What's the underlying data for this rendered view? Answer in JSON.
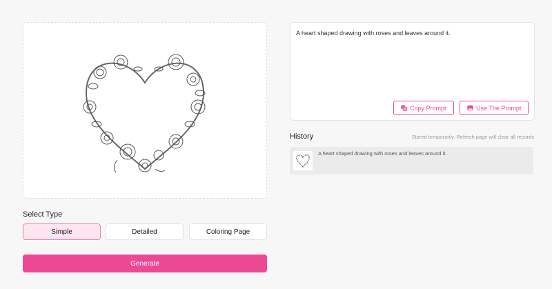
{
  "image": {
    "icon": "heart-rose-wreath-drawing"
  },
  "select_type": {
    "label": "Select Type",
    "options": [
      "Simple",
      "Detailed",
      "Coloring Page"
    ],
    "selected": "Simple"
  },
  "generate_label": "Generate",
  "prompt": {
    "text": "A heart shaped drawing with roses and leaves around it.",
    "copy_label": "Copy Prompt",
    "use_label": "Use The Prompt"
  },
  "history": {
    "title": "History",
    "note": "Stored temporarily. Refresh page will clear all records",
    "items": [
      {
        "text": "A heart shaped drawing with roses and leaves around it."
      }
    ]
  },
  "colors": {
    "accent": "#ec4894",
    "selected_bg": "#fde6ef"
  }
}
